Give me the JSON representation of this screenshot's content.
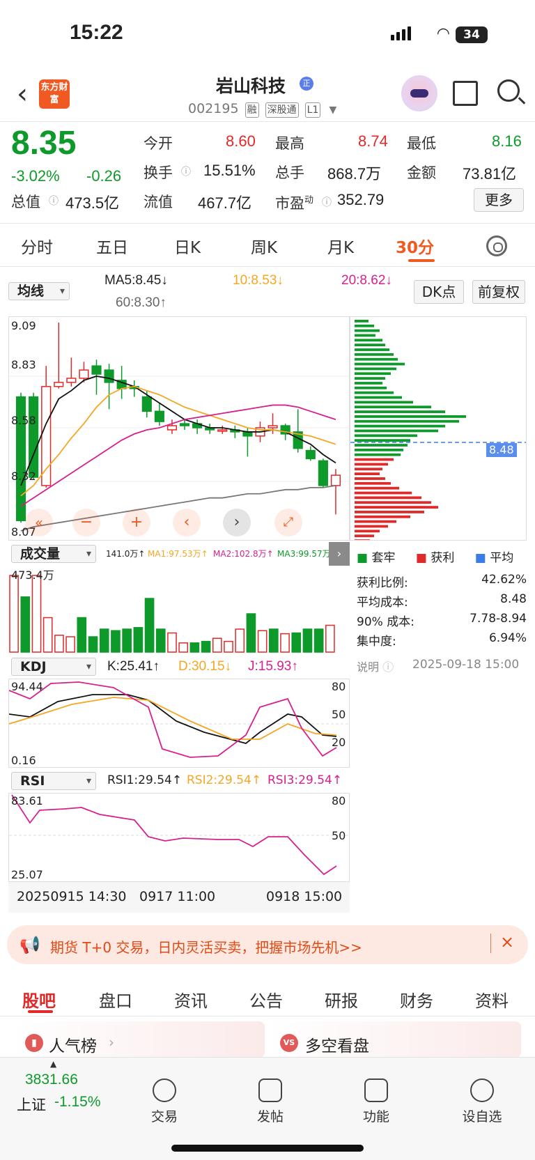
{
  "status_bar": {
    "time": "15:22",
    "battery": "34"
  },
  "header": {
    "logo_text": "东方财富",
    "stock_name": "岩山科技",
    "badge": "正",
    "code": "002195",
    "tags": [
      "融",
      "深股通",
      "L1"
    ]
  },
  "quote": {
    "price": "8.35",
    "change_pct": "-3.02%",
    "change": "-0.26",
    "open_label": "今开",
    "open": "8.60",
    "high_label": "最高",
    "high": "8.74",
    "low_label": "最低",
    "low": "8.16",
    "turnover_label": "换手",
    "turnover": "15.51%",
    "volume_label": "总手",
    "volume": "868.7万",
    "amount_label": "金额",
    "amount": "73.81亿",
    "total_value_label": "总值",
    "total_value": "473.5亿",
    "float_value_label": "流值",
    "float_value": "467.7亿",
    "pe_label": "市盈",
    "pe_sup": "动",
    "pe": "352.79",
    "more_label": "更多"
  },
  "period_tabs": [
    "分时",
    "五日",
    "日K",
    "周K",
    "月K",
    "30分"
  ],
  "active_period": "30分",
  "ma_bar": {
    "select_label": "均线",
    "ma5": "MA5:8.45↓",
    "ma10": "10:8.53↓",
    "ma20": "20:8.62↓",
    "ma60": "60:8.30↑",
    "dk_label": "DK点",
    "restore_label": "前复权"
  },
  "kline": {
    "y_labels": [
      "9.09",
      "8.83",
      "8.58",
      "8.32",
      "8.07"
    ],
    "current_marker": "8.48"
  },
  "volume_panel": {
    "select_label": "成交量",
    "vol": "141.0万↑",
    "ma1": "MA1:97.53万↑",
    "ma2": "MA2:102.8万↑",
    "ma3": "MA3:99.57万↑",
    "max_label": "473.4万"
  },
  "kdj_panel": {
    "select_label": "KDJ",
    "k": "K:25.41↑",
    "d": "D:30.15↓",
    "j": "J:15.93↑",
    "top_label": "94.44",
    "bottom_label": "0.16",
    "levels": [
      "80",
      "50",
      "20"
    ]
  },
  "rsi_panel": {
    "select_label": "RSI",
    "rsi1": "RSI1:29.54↑",
    "rsi2": "RSI2:29.54↑",
    "rsi3": "RSI3:29.54↑",
    "top_label": "83.61",
    "bottom_label": "25.07",
    "levels": [
      "80",
      "50"
    ]
  },
  "x_axis": [
    "20250915 14:30",
    "0917 11:00",
    "0918 15:00"
  ],
  "chip_legend": [
    "套牢",
    "获利",
    "平均"
  ],
  "chip_stats": [
    {
      "label": "获利比例:",
      "value": "42.62%"
    },
    {
      "label": "平均成本:",
      "value": "8.48"
    },
    {
      "label": "90% 成本:",
      "value": "7.78-8.94"
    },
    {
      "label": "集中度:",
      "value": "6.94%"
    }
  ],
  "chip_note": {
    "label": "说明",
    "date": "2025-09-18 15:00"
  },
  "ad_text": "期货 T+0 交易，日内灵活买卖，把握市场先机>>",
  "bottom_tabs": [
    "股吧",
    "盘口",
    "资讯",
    "公告",
    "研报",
    "财务",
    "资料"
  ],
  "cards": [
    "人气榜",
    "多空看盘"
  ],
  "nav": {
    "index_value": "3831.66",
    "index_name": "上证",
    "index_change": "-1.15%",
    "items": [
      "交易",
      "发帖",
      "功能",
      "设自选"
    ]
  },
  "colors": {
    "up": "#e02a2a",
    "down": "#0e9a2a",
    "accent": "#f05a22",
    "ma10": "#f5a623",
    "ma20": "#d6208f"
  }
}
